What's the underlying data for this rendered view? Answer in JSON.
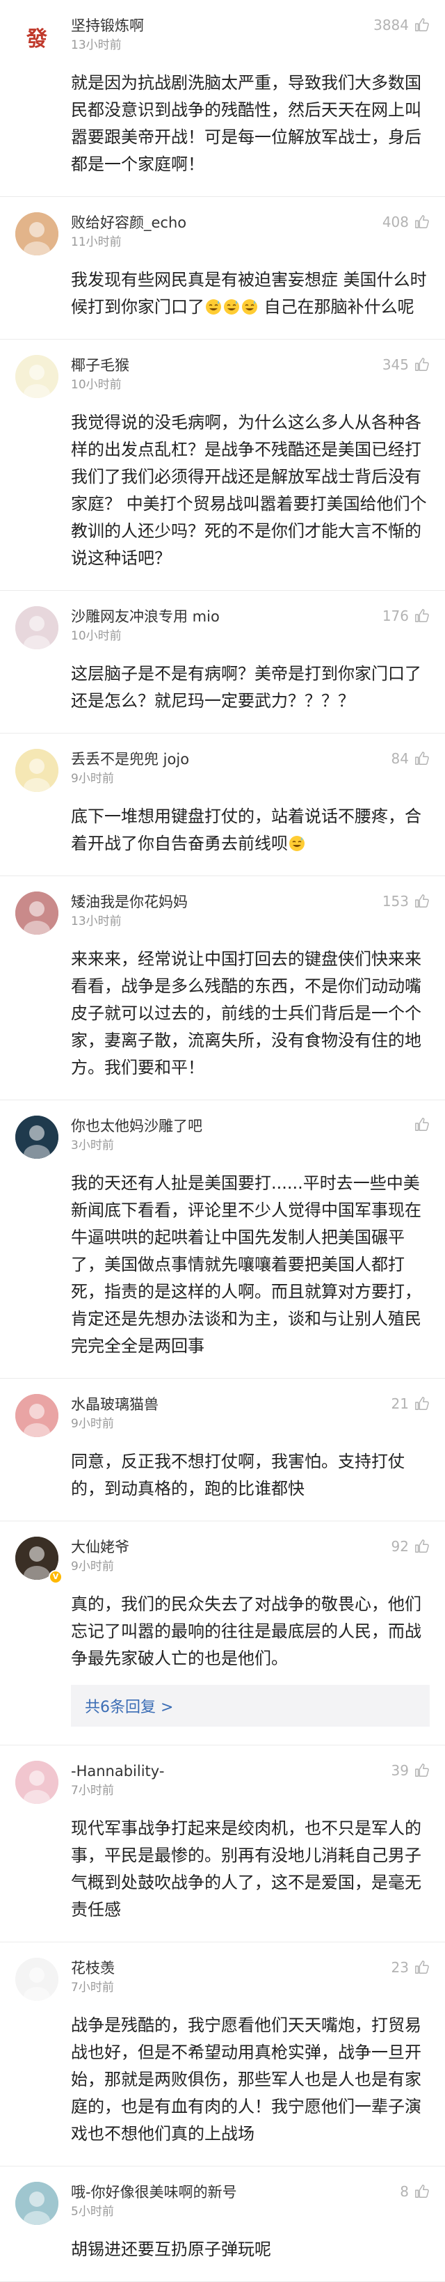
{
  "comments": [
    {
      "username": "坚持锻炼啊",
      "time": "13小时前",
      "likes": "3884",
      "avatar_char": "發",
      "avatar_bg": "#ffffff",
      "avatar_fg": "#c0392b",
      "text": "就是因为抗战剧洗脑太严重，导致我们大多数国民都没意识到战争的残酷性，然后天天在网上叫嚣要跟美帝开战！可是每一位解放军战士，身后都是一个家庭啊！"
    },
    {
      "username": "败给好容颜_echo",
      "time": "11小时前",
      "likes": "408",
      "avatar_char": "",
      "avatar_bg": "#e2b48a",
      "avatar_fg": "#ffffff",
      "text_before": "我发现有些网民真是有被迫害妄想症  美国什么时候打到你家门口了",
      "text_after": "  自己在那脑补什么呢",
      "emoji_count": 3
    },
    {
      "username": "椰子毛猴",
      "time": "10小时前",
      "likes": "345",
      "avatar_char": "",
      "avatar_bg": "#f6f1d6",
      "avatar_fg": "#ffffff",
      "text": "我觉得说的没毛病啊，为什么这么多人从各种各样的出发点乱杠？是战争不残酷还是美国已经打我们了我们必须得开战还是解放军战士背后没有家庭？  中美打个贸易战叫嚣着要打美国给他们个教训的人还少吗？死的不是你们才能大言不惭的说这种话吧？"
    },
    {
      "username": "沙雕网友冲浪专用 mio",
      "time": "10小时前",
      "likes": "176",
      "avatar_char": "",
      "avatar_bg": "#e7d7dc",
      "avatar_fg": "#ffffff",
      "text": "这层脑子是不是有病啊？美帝是打到你家门口了还是怎么？就尼玛一定要武力？？？？"
    },
    {
      "username": "丢丢不是兜兜 jojo",
      "time": "9小时前",
      "likes": "84",
      "avatar_char": "",
      "avatar_bg": "#f5e7b4",
      "avatar_fg": "#ffffff",
      "text_before": "底下一堆想用键盘打仗的，站着说话不腰疼，合着开战了你自告奋勇去前线呗",
      "text_after": "",
      "emoji_count": 1
    },
    {
      "username": "矮油我是你花妈妈",
      "time": "13小时前",
      "likes": "153",
      "avatar_char": "",
      "avatar_bg": "#c98a8a",
      "avatar_fg": "#ffffff",
      "text": "来来来，经常说让中国打回去的键盘侠们快来来看看，战争是多么残酷的东西，不是你们动动嘴皮子就可以过去的，前线的士兵们背后是一个个家，妻离子散，流离失所，没有食物没有住的地方。我们要和平！"
    },
    {
      "username": "你也太他妈沙雕了吧",
      "time": "3小时前",
      "likes": "",
      "avatar_char": "",
      "avatar_bg": "#1f3a4d",
      "avatar_fg": "#ffffff",
      "text": "我的天还有人扯是美国要打......平时去一些中美新闻底下看看，评论里不少人觉得中国军事现在牛逼哄哄的起哄着让中国先发制人把美国碾平了，美国做点事情就先嚷嚷着要把美国人都打死，指责的是这样的人啊。而且就算对方要打，肯定还是先想办法谈和为主，谈和与让别人殖民完完全全是两回事"
    },
    {
      "username": "水晶玻璃猫兽",
      "time": "9小时前",
      "likes": "21",
      "avatar_char": "",
      "avatar_bg": "#e9a4a4",
      "avatar_fg": "#ffffff",
      "text": "同意，反正我不想打仗啊，我害怕。支持打仗的，到动真格的，跑的比谁都快"
    },
    {
      "username": "大仙姥爷",
      "time": "9小时前",
      "likes": "92",
      "avatar_char": "",
      "avatar_bg": "#3a2f25",
      "avatar_fg": "#ffffff",
      "has_badge": true,
      "badge_text": "V",
      "text": "真的，我们的民众失去了对战争的敬畏心，他们忘记了叫嚣的最响的往往是最底层的人民，而战争最先家破人亡的也是他们。",
      "replies_label": "共6条回复 >"
    },
    {
      "username": "-Hannability-",
      "time": "7小时前",
      "likes": "39",
      "avatar_char": "",
      "avatar_bg": "#f1c6cf",
      "avatar_fg": "#ffffff",
      "text": "现代军事战争打起来是绞肉机，也不只是军人的事，平民是最惨的。别再有没地儿消耗自己男子气概到处鼓吹战争的人了，这不是爱国，是毫无责任感"
    },
    {
      "username": "花枝羡",
      "time": "7小时前",
      "likes": "23",
      "avatar_char": "",
      "avatar_bg": "#f4f4f4",
      "avatar_fg": "#ffffff",
      "text": "战争是残酷的，我宁愿看他们天天嘴炮，打贸易战也好，但是不希望动用真枪实弹，战争一旦开始，那就是两败俱伤，那些军人也是人也是有家庭的，也是有血有肉的人！我宁愿他们一辈子演戏也不想他们真的上战场"
    },
    {
      "username": "哦-你好像很美味啊的新号",
      "time": "5小时前",
      "likes": "8",
      "avatar_char": "",
      "avatar_bg": "#9fc6cf",
      "avatar_fg": "#ffffff",
      "text": "胡锡进还要互扔原子弹玩呢"
    }
  ],
  "icons": {
    "like": "thumbs-up-icon",
    "emoji": "grin-sweat-emoji-icon"
  },
  "colors": {
    "link": "#3b6db5",
    "muted": "#9a9a9a",
    "divider": "#ebebeb"
  }
}
